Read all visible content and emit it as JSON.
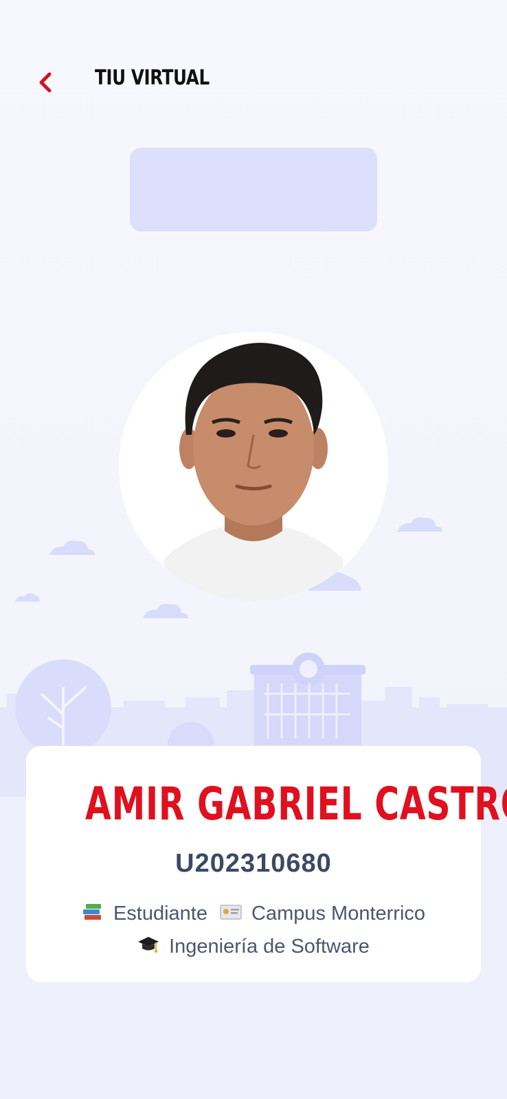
{
  "header": {
    "title": "TIU VIRTUAL",
    "back_icon": "chevron-left-icon"
  },
  "profile": {
    "name": "AMIR GABRIEL CASTRO",
    "code": "U202310680",
    "role": "Estudiante",
    "campus": "Campus Monterrico",
    "career": "Ingeniería de Software"
  },
  "icons": {
    "role": "books-icon",
    "campus": "id-card-icon",
    "career": "graduation-cap-icon"
  },
  "colors": {
    "accent": "#e0101f",
    "banner": "#dedffc",
    "scene": "#dfe1fb"
  }
}
